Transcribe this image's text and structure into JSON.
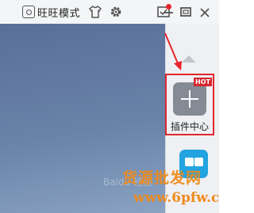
{
  "titlebar": {
    "mode_label": "旺旺模式",
    "icons": [
      "mode-icon",
      "shirt-icon",
      "gear-icon",
      "message-icon",
      "minimize-icon",
      "maximize-icon",
      "close-icon"
    ],
    "notification_color": "#e8242b"
  },
  "plugins": {
    "hot_badge": "HOT",
    "plugin_center_label": "插件中心",
    "highlight_color": "#e2262d"
  },
  "app_tile": {
    "color": "#22a4e0"
  },
  "watermark": {
    "line1": "货源批发网",
    "url": "www.6pfw.cn",
    "faint": "Baidu 经验",
    "color": "#f08a1c"
  }
}
